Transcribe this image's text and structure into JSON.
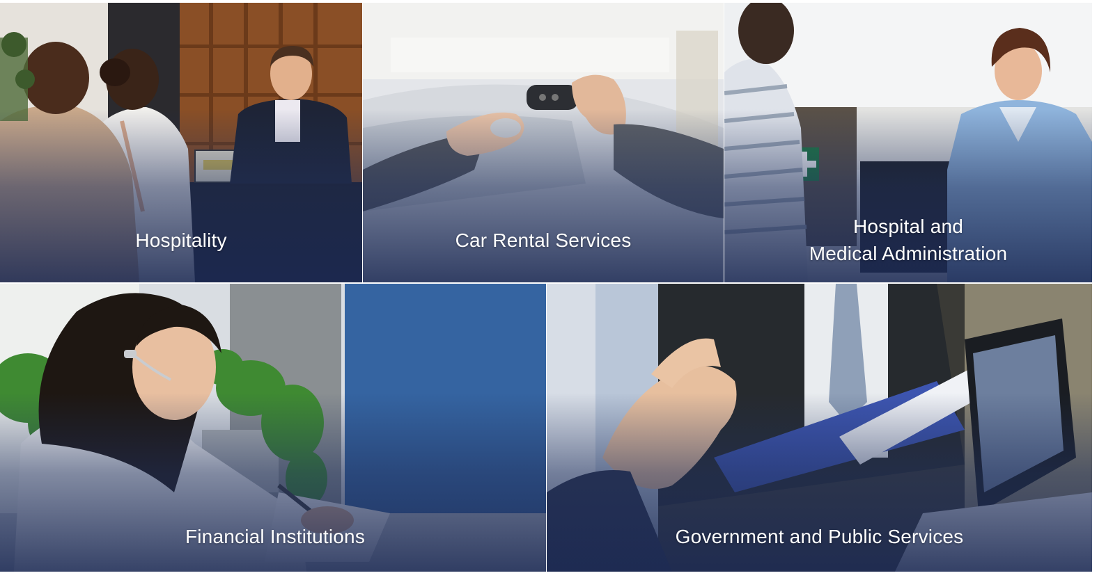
{
  "tiles": [
    {
      "label_line1": "Hospitality",
      "label_line2": ""
    },
    {
      "label_line1": "Car Rental Services",
      "label_line2": ""
    },
    {
      "label_line1": "Hospital and",
      "label_line2": "Medical Administration"
    },
    {
      "label_line1": "Financial Institutions",
      "label_line2": ""
    },
    {
      "label_line1": "Government and Public Services",
      "label_line2": ""
    }
  ],
  "colors": {
    "overlay": "#1c2a54",
    "label_text": "#ffffff",
    "blue_panel": "#3b6aa8",
    "wood": "#9a5a2c",
    "scrubs": "#8fb4dc"
  }
}
